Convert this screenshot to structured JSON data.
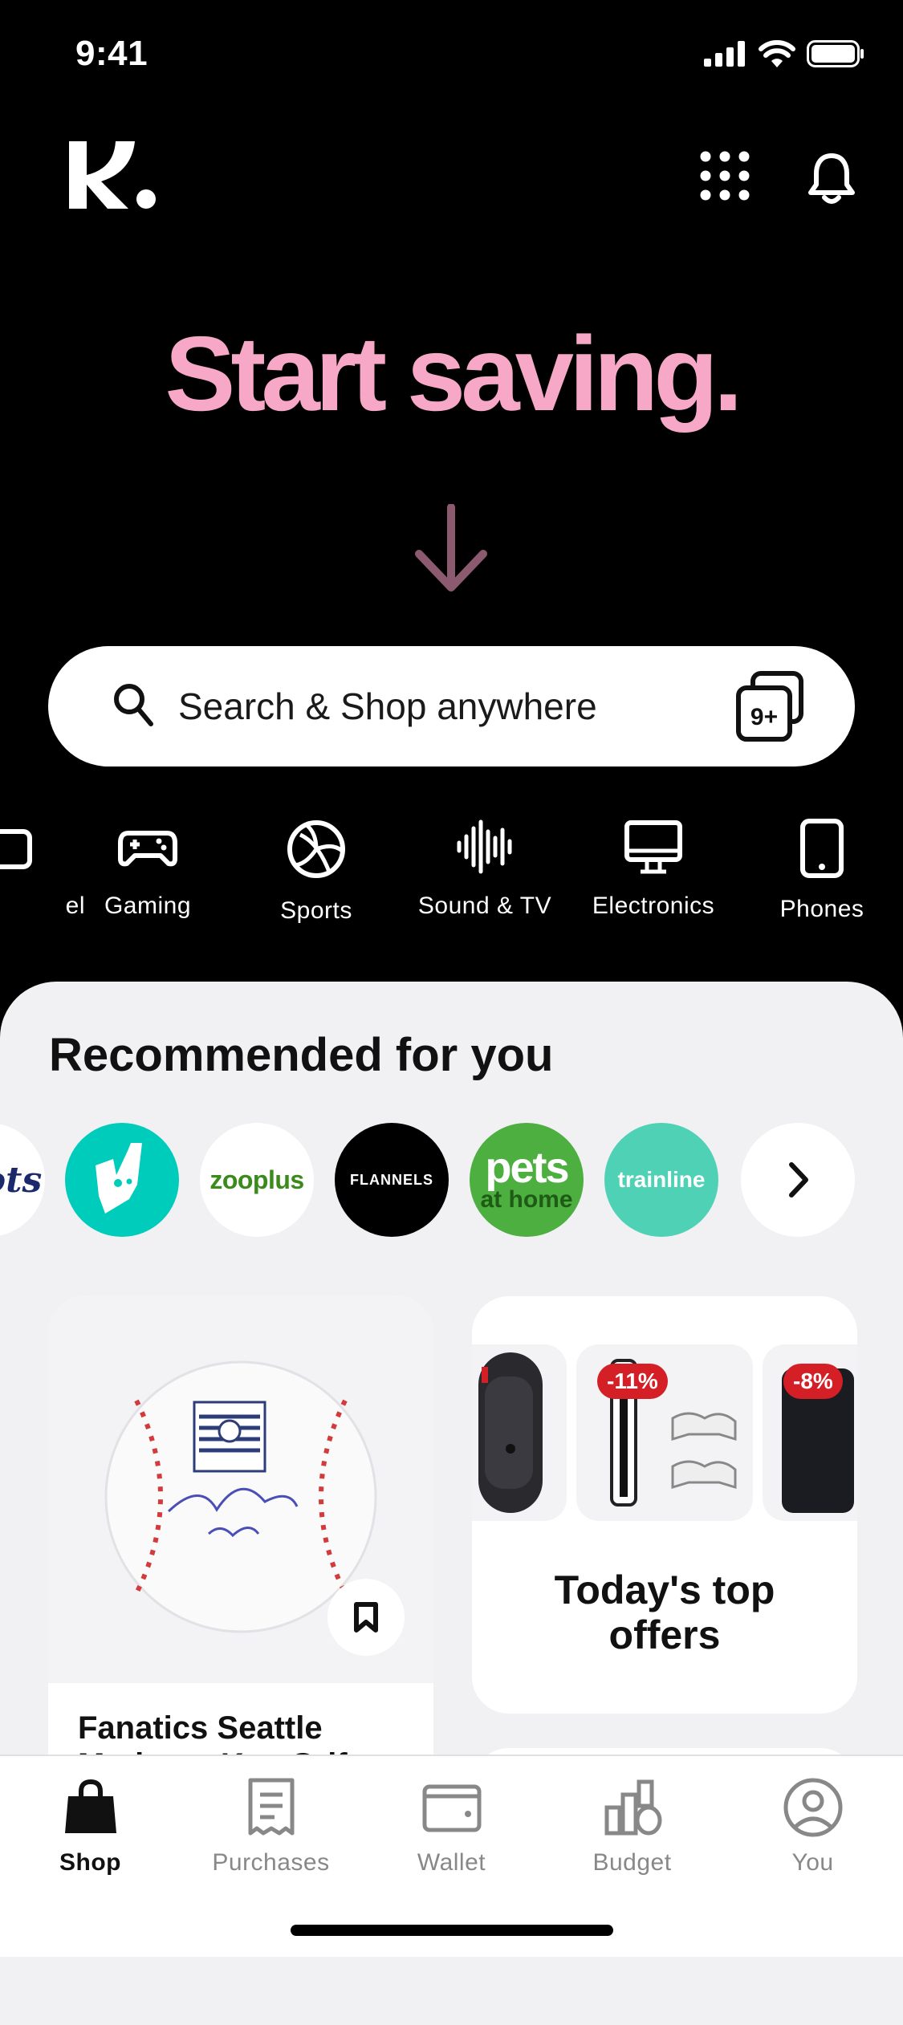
{
  "status_bar": {
    "time": "9:41"
  },
  "header": {
    "logo_text": "K."
  },
  "hero": {
    "headline": "Start saving."
  },
  "search": {
    "placeholder": "Search & Shop anywhere",
    "badge": "9+"
  },
  "categories": [
    {
      "label": "el",
      "icon": "suitcase-icon"
    },
    {
      "label": "Gaming",
      "icon": "gamepad-icon"
    },
    {
      "label": "Sports",
      "icon": "volleyball-icon"
    },
    {
      "label": "Sound & TV",
      "icon": "soundwave-icon"
    },
    {
      "label": "Electronics",
      "icon": "monitor-icon"
    },
    {
      "label": "Phones",
      "icon": "phone-icon"
    }
  ],
  "recommended": {
    "title": "Recommended for you",
    "brands": [
      {
        "name": "Sports",
        "text": "ots",
        "bg": "#ffffff",
        "fg": "#1b2a6b"
      },
      {
        "name": "Deliveroo",
        "text": "",
        "bg": "#00ccbc",
        "fg": "#ffffff"
      },
      {
        "name": "zooplus",
        "text": "zooplus",
        "bg": "#ffffff",
        "fg": "#3a8b1c"
      },
      {
        "name": "Flannels",
        "text": "FLANNELS",
        "bg": "#000000",
        "fg": "#ffffff"
      },
      {
        "name": "Pets at Home",
        "text": "pets",
        "sub": "at home",
        "bg": "#4caf3f",
        "fg": "#ffffff"
      },
      {
        "name": "Trainline",
        "text": "trainline",
        "bg": "#4fd1b5",
        "fg": "#ffffff"
      }
    ]
  },
  "product_card": {
    "title_line1": "Fanatics Seattle",
    "title_line2": "Mariners Ken Grif"
  },
  "offers_card": {
    "title_line1": "Today's top",
    "title_line2": "offers",
    "discounts": [
      "-11%",
      "-8%"
    ]
  },
  "tabs": [
    {
      "label": "Shop",
      "icon": "shopping-bag-icon",
      "active": true
    },
    {
      "label": "Purchases",
      "icon": "receipt-icon",
      "active": false
    },
    {
      "label": "Wallet",
      "icon": "wallet-icon",
      "active": false
    },
    {
      "label": "Budget",
      "icon": "budget-icon",
      "active": false
    },
    {
      "label": "You",
      "icon": "user-icon",
      "active": false
    }
  ],
  "colors": {
    "accent_pink": "#f7a8c7",
    "background": "#000000",
    "sheet": "#f1f1f4",
    "discount_red": "#d51f26"
  }
}
